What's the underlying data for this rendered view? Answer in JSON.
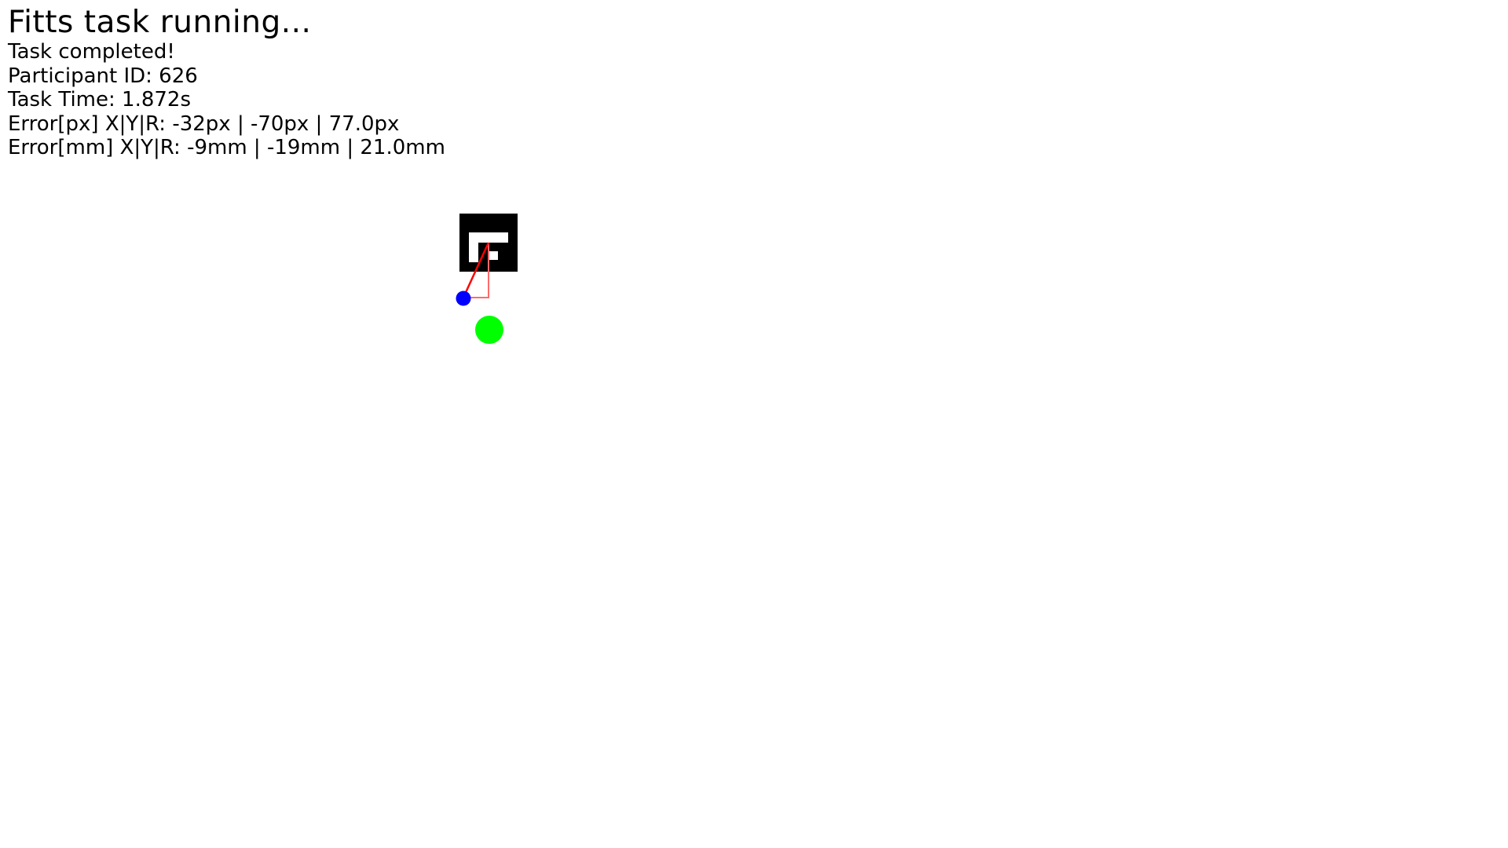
{
  "status": {
    "title": "Fitts task running...",
    "completion": "Task completed!",
    "participant": "Participant ID: 626",
    "task_time": "Task Time: 1.872s",
    "error_px": "Error[px] X|Y|R: -32px | -70px | 77.0px",
    "error_mm": "Error[mm] X|Y|R: -9mm | -19mm | 21.0mm"
  },
  "scene": {
    "marker_icon": "aruco-marker-icon",
    "cursor_icon": "blue-dot-icon",
    "target_icon": "green-dot-icon",
    "colors": {
      "marker": "#000000",
      "cursor": "#0000ff",
      "target": "#00ff00",
      "error_line": "#ff0000",
      "error_components": "#ff6a6a"
    }
  }
}
